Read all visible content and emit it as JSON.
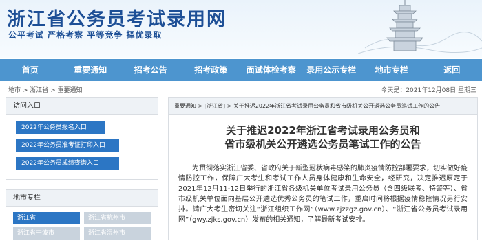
{
  "header": {
    "site_title": "浙江省公务员考试录用网",
    "slogan": "公平考试  严格考察  平等竞争  择优录取"
  },
  "nav": {
    "items": [
      "首页",
      "重要通知",
      "招考公告",
      "招考政策",
      "面试体检考察",
      "录用公示专栏",
      "地市专栏",
      "返回"
    ]
  },
  "breadcrumb": {
    "path": "地市 > 浙江省 > 重要通知",
    "date": "今天是：2021年12月08日 星期三"
  },
  "sidebar": {
    "entry_title": "访问入口",
    "links": [
      "2022年公务员报名入口",
      "2022年公务员准考证打印入口",
      "2022年公务员成绩查询入口"
    ],
    "city_title": "地市专栏",
    "cities": [
      "浙江省",
      "浙江省杭州市",
      "浙江省宁波市",
      "浙江省温州市"
    ]
  },
  "article": {
    "breadcrumb": "重要通知 > [浙江省] > 关于推迟2022年浙江省考试录用公务员和省市级机关公开遴选公务员笔试工作的公告",
    "title_line1": "关于推迟2022年浙江省考试录用公务员和",
    "title_line2": "省市级机关公开遴选公务员笔试工作的公告",
    "body": "为贯彻落实浙江省委、省政府关于新型冠状病毒感染的肺炎疫情防控部署要求，切实做好疫情防控工作，保障广大考生和考试工作人员身体健康和生命安全，经研究，决定推迟原定于2021年12月11-12日举行的浙江省各级机关单位考试录用公务员（含四级联考、特警等）、省市级机关单位面向基层公开遴选优秀公务员的笔试工作，重启时间将根据疫情稳控情况另行安排。请广大考生密切关注“浙江组织工作网”（www.zjzzgz.gov.cn）、“浙江省公务员考试录用网”（gwy.zjks.gov.cn）发布的相关通知，了解最新考试安排。"
  },
  "colors": {
    "nav": "#4d95cf",
    "title_blue": "#1d4f96",
    "link_blue": "#2c76c4"
  }
}
